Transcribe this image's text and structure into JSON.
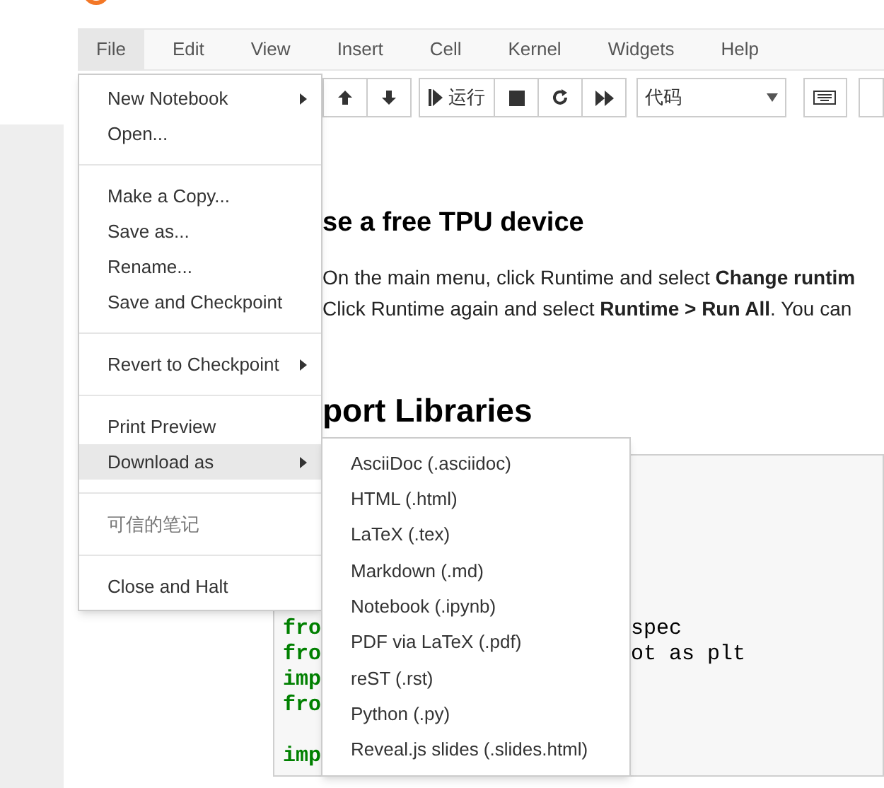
{
  "menubar": [
    {
      "label": "File",
      "selected": true
    },
    {
      "label": "Edit",
      "selected": false
    },
    {
      "label": "View",
      "selected": false
    },
    {
      "label": "Insert",
      "selected": false
    },
    {
      "label": "Cell",
      "selected": false
    },
    {
      "label": "Kernel",
      "selected": false
    },
    {
      "label": "Widgets",
      "selected": false
    },
    {
      "label": "Help",
      "selected": false
    }
  ],
  "toolbar": {
    "run_label": "运行",
    "cell_type": "代码"
  },
  "notebook": {
    "heading_1": "se a free TPU device",
    "paragraph_lines": [
      "On the main menu, click Runtime and select **Change runtim**",
      "Click Runtime again and select **Runtime > Run All**. You can"
    ],
    "heading_2": "port Libraries",
    "code_blocks": [
      [
        {
          "left": "fro",
          "right": "spec"
        },
        {
          "left": "fro",
          "right": "ot as plt"
        },
        {
          "left": "imp"
        },
        {
          "left": "fro"
        }
      ],
      [
        {
          "left": "imp"
        }
      ]
    ]
  },
  "file_menu": {
    "groups": [
      [
        {
          "label": "New Notebook",
          "submenu": true,
          "selected": false,
          "disabled": false
        },
        {
          "label": "Open...",
          "submenu": false,
          "selected": false,
          "disabled": false
        }
      ],
      [
        {
          "label": "Make a Copy...",
          "submenu": false,
          "selected": false,
          "disabled": false
        },
        {
          "label": "Save as...",
          "submenu": false,
          "selected": false,
          "disabled": false
        },
        {
          "label": "Rename...",
          "submenu": false,
          "selected": false,
          "disabled": false
        },
        {
          "label": "Save and Checkpoint",
          "submenu": false,
          "selected": false,
          "disabled": false
        }
      ],
      [
        {
          "label": "Revert to Checkpoint",
          "submenu": true,
          "selected": false,
          "disabled": false
        }
      ],
      [
        {
          "label": "Print Preview",
          "submenu": false,
          "selected": false,
          "disabled": false
        },
        {
          "label": "Download as",
          "submenu": true,
          "selected": true,
          "disabled": false
        }
      ],
      [
        {
          "label": "可信的笔记",
          "submenu": false,
          "selected": false,
          "disabled": true
        }
      ],
      [
        {
          "label": "Close and Halt",
          "submenu": false,
          "selected": false,
          "disabled": false
        }
      ]
    ]
  },
  "download_menu": [
    "AsciiDoc (.asciidoc)",
    "HTML (.html)",
    "LaTeX (.tex)",
    "Markdown (.md)",
    "Notebook (.ipynb)",
    "PDF via LaTeX (.pdf)",
    "reST (.rst)",
    "Python (.py)",
    "Reveal.js slides (.slides.html)"
  ]
}
